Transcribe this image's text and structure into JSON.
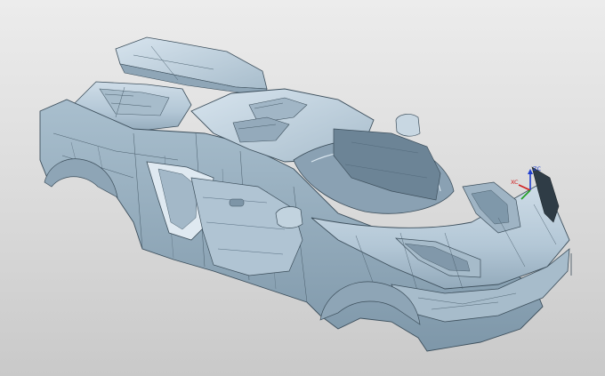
{
  "viewport": {
    "background_top": "#ececec",
    "background_bottom": "#c9c9c9"
  },
  "model": {
    "type": "car-body-surface-model",
    "body_color": "#b9cbd9",
    "shade_color": "#7f98aa",
    "dark_color": "#5f7686",
    "highlight_color": "#dbe7f0",
    "edge_color": "#3d4f5c"
  },
  "triad": {
    "zc_label": "ZC",
    "xc_label": "XC",
    "zc_color": "#1f3fd0",
    "xc_color": "#d02020",
    "yc_color": "#20a020"
  }
}
